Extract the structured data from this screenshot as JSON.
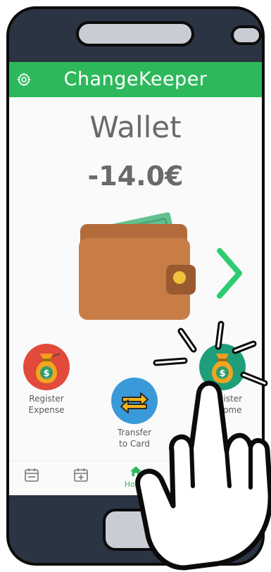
{
  "app": {
    "title": "ChangeKeeper"
  },
  "wallet": {
    "title": "Wallet",
    "balance": "-14.0€"
  },
  "actions": {
    "register_expense": {
      "line1": "Register",
      "line2": "Expense",
      "color": "#e24a3b"
    },
    "transfer_to_card": {
      "line1": "Transfer",
      "line2": "to Card",
      "color": "#3a9ad9"
    },
    "register_income": {
      "line1": "gister",
      "line2": "come",
      "color": "#1f9e7a"
    }
  },
  "bottom_nav": {
    "home_label": "Home"
  },
  "colors": {
    "accent": "#2eb85c",
    "text": "#6a6a6a",
    "phone_body": "#2b3442"
  },
  "icons": [
    "gear-icon",
    "wallet-icon",
    "chevron-right-icon",
    "money-bag-icon",
    "transfer-arrows-icon",
    "calendar-icon",
    "calendar-add-icon",
    "home-icon",
    "pointing-hand-icon"
  ]
}
